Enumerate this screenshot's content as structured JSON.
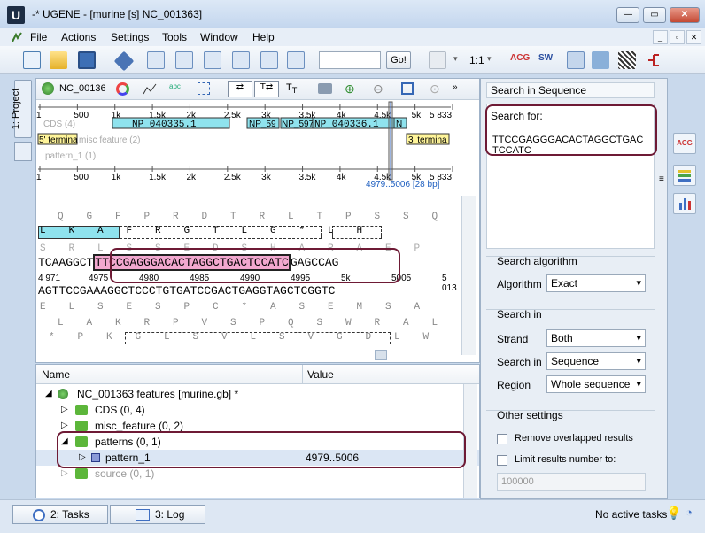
{
  "window": {
    "app_icon": "U",
    "title": "-* UGENE - [murine [s] NC_001363]",
    "controls": {
      "minimize": "—",
      "maximize": "▭",
      "close": "✕"
    }
  },
  "menu": [
    "File",
    "Actions",
    "Settings",
    "Tools",
    "Window",
    "Help"
  ],
  "toolbar": {
    "go_label": "Go!",
    "zoom_ratio": "1:1",
    "search_value": ""
  },
  "left_dock": {
    "project_tab": "1: Project"
  },
  "sequence_view": {
    "name": "NC_00136",
    "overview_ticks": [
      "1",
      "500",
      "1k",
      "1.5k",
      "2k",
      "2.5k",
      "3k",
      "3.5k",
      "4k",
      "4.5k",
      "5k",
      "5 833"
    ],
    "ruler_ticks_bottom": [
      "1",
      "500",
      "1k",
      "1.5k",
      "2k",
      "2.5k",
      "3k",
      "3.5k",
      "4k",
      "4.5k",
      "5k",
      "5 833"
    ],
    "tracks": {
      "cds_label": "CDS (4)",
      "misc_label": "misc feature (2)",
      "pattern_label": "pattern_1 (1)",
      "five_prime_left": "5' termina",
      "five_prime_right": "3' termina",
      "np1": "NP 040335.1",
      "np2": "NP_59",
      "np3": "NP_597",
      "np4": "NP_040336.1",
      "np5": "N"
    },
    "selection_range": "4979..5006 [28 bp]",
    "frame_top": [
      "Q",
      "G",
      "F",
      "P",
      "R",
      "D",
      "T",
      "R",
      "L",
      "T",
      "P",
      "S",
      "S",
      "Q"
    ],
    "frame_mid": [
      "L",
      "K",
      "A",
      "F",
      "R",
      "G",
      "T",
      "L",
      "G",
      "*",
      "L",
      "H"
    ],
    "frame_bot": [
      "S",
      "R",
      "L",
      "S",
      "S",
      "E",
      "D",
      "S",
      "H",
      "A",
      "R",
      "A",
      "E",
      "P"
    ],
    "dna_top_prefix": "TCAAGGCT",
    "dna_top_highlight": "TTCCGAGGGACACTAGGCTGACTCCATC",
    "dna_top_suffix": "GAGCCAG",
    "position_ticks": [
      "4 971",
      "4975",
      "4980",
      "4985",
      "4990",
      "4995",
      "5k",
      "5005",
      "5 013"
    ],
    "dna_bottom": "AGTTCCGAAAGGCTCCCTGTGATCCGACTGAGGTAGCTCGGTC",
    "rev_frame1": [
      "E",
      "L",
      "S",
      "E",
      "S",
      "P",
      "C",
      "*",
      "A",
      "S",
      "E",
      "M",
      "S",
      "A"
    ],
    "rev_frame2": [
      "L",
      "A",
      "K",
      "R",
      "P",
      "V",
      "S",
      "P",
      "Q",
      "S",
      "W",
      "R",
      "A",
      "L"
    ],
    "rev_frame3": [
      "*",
      "P",
      "K",
      "G",
      "L",
      "S",
      "V",
      "L",
      "S",
      "V",
      "G",
      "D",
      "L",
      "W"
    ]
  },
  "feature_tree": {
    "col_name": "Name",
    "col_value": "Value",
    "root": "NC_001363 features [murine.gb] *",
    "items": [
      {
        "label": "CDS  (0, 4)",
        "value": ""
      },
      {
        "label": "misc_feature  (0, 2)",
        "value": ""
      },
      {
        "label": "patterns  (0, 1)",
        "value": ""
      },
      {
        "label": "pattern_1",
        "value": "4979..5006"
      },
      {
        "label": "source  (0, 1)",
        "value": ""
      }
    ]
  },
  "search_panel": {
    "title": "Search in Sequence",
    "search_for_label": "Search for:",
    "pattern": "TTCCGAGGGACACTAGGCTGACTCCATC",
    "algo_group": "Search algorithm",
    "algorithm_label": "Algorithm",
    "algorithm_value": "Exact",
    "search_in_group": "Search in",
    "strand_label": "Strand",
    "strand_value": "Both",
    "search_in_label": "Search in",
    "search_in_value": "Sequence",
    "region_label": "Region",
    "region_value": "Whole sequence",
    "other_group": "Other settings",
    "remove_overlapped": "Remove overlapped results",
    "limit_results": "Limit results number to:",
    "limit_value": "100000"
  },
  "status": {
    "tasks_tab": "2: Tasks",
    "log_tab": "3: Log",
    "no_tasks": "No active tasks"
  },
  "colors": {
    "highlight_border": "#6e1a35",
    "cds_fill": "#8fe3ee",
    "five_prime_fill": "#fff59a",
    "pattern_fill": "#f2a8cf",
    "feature_green": "#5cb63a"
  }
}
